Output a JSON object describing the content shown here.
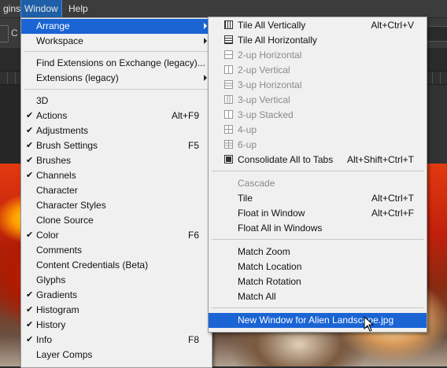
{
  "menubar": {
    "items": [
      {
        "label": "gins"
      },
      {
        "label": "Window"
      },
      {
        "label": "Help"
      }
    ]
  },
  "options_bar": {
    "partial_char": "C"
  },
  "window_menu": {
    "items": [
      {
        "label": "Arrange",
        "submenu": true,
        "highlighted": true
      },
      {
        "label": "Workspace",
        "submenu": true
      },
      {
        "label": "Find Extensions on Exchange (legacy)..."
      },
      {
        "label": "Extensions (legacy)",
        "submenu": true
      },
      {
        "label": "3D"
      },
      {
        "label": "Actions",
        "checked": true,
        "shortcut": "Alt+F9"
      },
      {
        "label": "Adjustments",
        "checked": true
      },
      {
        "label": "Brush Settings",
        "checked": true,
        "shortcut": "F5"
      },
      {
        "label": "Brushes",
        "checked": true
      },
      {
        "label": "Channels",
        "checked": true
      },
      {
        "label": "Character"
      },
      {
        "label": "Character Styles"
      },
      {
        "label": "Clone Source"
      },
      {
        "label": "Color",
        "checked": true,
        "shortcut": "F6"
      },
      {
        "label": "Comments"
      },
      {
        "label": "Content Credentials (Beta)"
      },
      {
        "label": "Glyphs"
      },
      {
        "label": "Gradients",
        "checked": true
      },
      {
        "label": "Histogram",
        "checked": true
      },
      {
        "label": "History",
        "checked": true
      },
      {
        "label": "Info",
        "checked": true,
        "shortcut": "F8"
      },
      {
        "label": "Layer Comps"
      }
    ]
  },
  "arrange_menu": {
    "items": [
      {
        "label": "Tile All Vertically",
        "shortcut": "Alt+Ctrl+V",
        "icon": "tile-vertical-icon"
      },
      {
        "label": "Tile All Horizontally",
        "icon": "tile-horizontal-icon"
      },
      {
        "label": "2-up Horizontal",
        "disabled": true,
        "icon": "2up-horizontal-icon"
      },
      {
        "label": "2-up Vertical",
        "disabled": true,
        "icon": "2up-vertical-icon"
      },
      {
        "label": "3-up Horizontal",
        "disabled": true,
        "icon": "3up-horizontal-icon"
      },
      {
        "label": "3-up Vertical",
        "disabled": true,
        "icon": "3up-vertical-icon"
      },
      {
        "label": "3-up Stacked",
        "disabled": true,
        "icon": "3up-stacked-icon"
      },
      {
        "label": "4-up",
        "disabled": true,
        "icon": "4up-icon"
      },
      {
        "label": "6-up",
        "disabled": true,
        "icon": "6up-icon"
      },
      {
        "label": "Consolidate All to Tabs",
        "shortcut": "Alt+Shift+Ctrl+T",
        "icon": "consolidate-tabs-icon"
      },
      {
        "label": "Cascade",
        "disabled": true
      },
      {
        "label": "Tile",
        "shortcut": "Alt+Ctrl+T"
      },
      {
        "label": "Float in Window",
        "shortcut": "Alt+Ctrl+F"
      },
      {
        "label": "Float All in Windows"
      },
      {
        "label": "Match Zoom"
      },
      {
        "label": "Match Location"
      },
      {
        "label": "Match Rotation"
      },
      {
        "label": "Match All"
      },
      {
        "label": "New Window for Alien Landscape.jpg",
        "highlighted": true
      }
    ]
  },
  "check_glyph": "✔"
}
